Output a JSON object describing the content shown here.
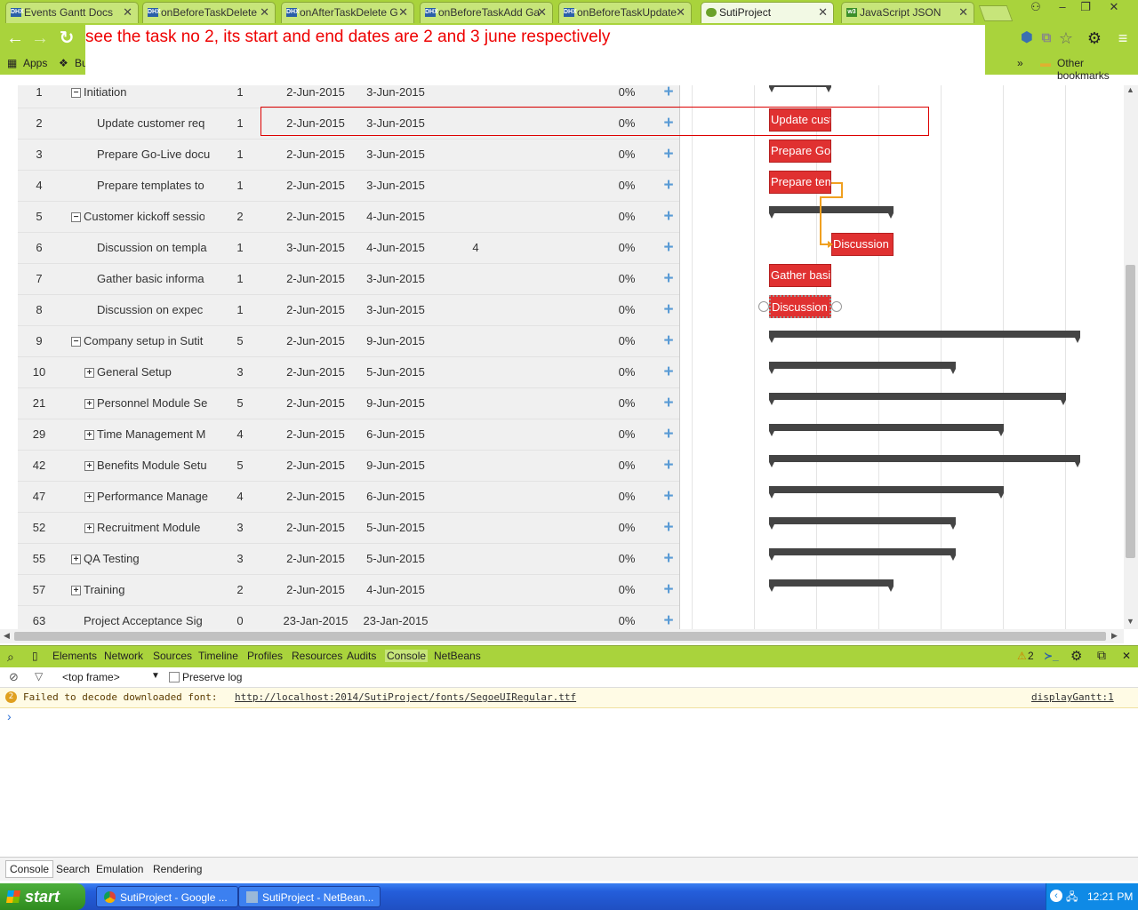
{
  "browser": {
    "tabs": [
      {
        "label": "Events Gantt Docs",
        "icon": "dhx-favicon"
      },
      {
        "label": "onBeforeTaskDelete",
        "icon": "dhx-favicon"
      },
      {
        "label": "onAfterTaskDelete G",
        "icon": "dhx-favicon"
      },
      {
        "label": "onBeforeTaskAdd Ga",
        "icon": "dhx-favicon"
      },
      {
        "label": "onBeforeTaskUpdate",
        "icon": "dhx-favicon"
      },
      {
        "label": "SutiProject",
        "icon": "suti-favicon"
      },
      {
        "label": "JavaScript JSON",
        "icon": "w3-favicon"
      }
    ],
    "bookmarks": {
      "apps": "Apps",
      "bu": "Bu",
      "chevron": "»",
      "other": "Other bookmarks"
    }
  },
  "notice": "see the task no 2, its start and end dates are 2 and 3 june respectively",
  "grid": {
    "rows": [
      {
        "id": "1",
        "name": "Initiation",
        "indent": 0,
        "toggle": "−",
        "dur": "1",
        "start": "2-Jun-2015",
        "end": "3-Jun-2015",
        "pred": "",
        "progress": "0%"
      },
      {
        "id": "2",
        "name": "Update customer req",
        "indent": 1,
        "toggle": "",
        "dur": "1",
        "start": "2-Jun-2015",
        "end": "3-Jun-2015",
        "pred": "",
        "progress": "0%"
      },
      {
        "id": "3",
        "name": "Prepare Go-Live docu",
        "indent": 1,
        "toggle": "",
        "dur": "1",
        "start": "2-Jun-2015",
        "end": "3-Jun-2015",
        "pred": "",
        "progress": "0%"
      },
      {
        "id": "4",
        "name": "Prepare templates to",
        "indent": 1,
        "toggle": "",
        "dur": "1",
        "start": "2-Jun-2015",
        "end": "3-Jun-2015",
        "pred": "",
        "progress": "0%"
      },
      {
        "id": "5",
        "name": "Customer kickoff sessio",
        "indent": 0,
        "toggle": "−",
        "dur": "2",
        "start": "2-Jun-2015",
        "end": "4-Jun-2015",
        "pred": "",
        "progress": "0%"
      },
      {
        "id": "6",
        "name": "Discussion on templa",
        "indent": 1,
        "toggle": "",
        "dur": "1",
        "start": "3-Jun-2015",
        "end": "4-Jun-2015",
        "pred": "4",
        "progress": "0%"
      },
      {
        "id": "7",
        "name": "Gather basic informa",
        "indent": 1,
        "toggle": "",
        "dur": "1",
        "start": "2-Jun-2015",
        "end": "3-Jun-2015",
        "pred": "",
        "progress": "0%"
      },
      {
        "id": "8",
        "name": "Discussion on expec",
        "indent": 1,
        "toggle": "",
        "dur": "1",
        "start": "2-Jun-2015",
        "end": "3-Jun-2015",
        "pred": "",
        "progress": "0%"
      },
      {
        "id": "9",
        "name": "Company setup in Sutit",
        "indent": 0,
        "toggle": "−",
        "dur": "5",
        "start": "2-Jun-2015",
        "end": "9-Jun-2015",
        "pred": "",
        "progress": "0%"
      },
      {
        "id": "10",
        "name": "General Setup",
        "indent": 1,
        "toggle": "+",
        "dur": "3",
        "start": "2-Jun-2015",
        "end": "5-Jun-2015",
        "pred": "",
        "progress": "0%"
      },
      {
        "id": "21",
        "name": "Personnel Module Se",
        "indent": 1,
        "toggle": "+",
        "dur": "5",
        "start": "2-Jun-2015",
        "end": "9-Jun-2015",
        "pred": "",
        "progress": "0%"
      },
      {
        "id": "29",
        "name": "Time Management M",
        "indent": 1,
        "toggle": "+",
        "dur": "4",
        "start": "2-Jun-2015",
        "end": "6-Jun-2015",
        "pred": "",
        "progress": "0%"
      },
      {
        "id": "42",
        "name": "Benefits Module Setu",
        "indent": 1,
        "toggle": "+",
        "dur": "5",
        "start": "2-Jun-2015",
        "end": "9-Jun-2015",
        "pred": "",
        "progress": "0%"
      },
      {
        "id": "47",
        "name": "Performance Manage",
        "indent": 1,
        "toggle": "+",
        "dur": "4",
        "start": "2-Jun-2015",
        "end": "6-Jun-2015",
        "pred": "",
        "progress": "0%"
      },
      {
        "id": "52",
        "name": "Recruitment Module",
        "indent": 1,
        "toggle": "+",
        "dur": "3",
        "start": "2-Jun-2015",
        "end": "5-Jun-2015",
        "pred": "",
        "progress": "0%"
      },
      {
        "id": "55",
        "name": "QA Testing",
        "indent": 0,
        "toggle": "+",
        "dur": "3",
        "start": "2-Jun-2015",
        "end": "5-Jun-2015",
        "pred": "",
        "progress": "0%"
      },
      {
        "id": "57",
        "name": "Training",
        "indent": 0,
        "toggle": "+",
        "dur": "2",
        "start": "2-Jun-2015",
        "end": "4-Jun-2015",
        "pred": "",
        "progress": "0%"
      },
      {
        "id": "63",
        "name": "Project Acceptance Sig",
        "indent": 0,
        "toggle": "",
        "dur": "0",
        "start": "23-Jan-2015",
        "end": "23-Jan-2015",
        "pred": "",
        "progress": "0%"
      }
    ],
    "add_symbol": "+"
  },
  "chart": {
    "bar_color": "#e03131",
    "project_color": "#444444",
    "link_color": "#f0a020",
    "bar_labels": [
      "Update custo",
      "Prepare Go-",
      "Prepare tem",
      "Discussion o",
      "Gather basic",
      "Discussion"
    ]
  },
  "devtools": {
    "tabs": [
      "Elements",
      "Network",
      "Sources",
      "Timeline",
      "Profiles",
      "Resources",
      "Audits",
      "Console",
      "NetBeans"
    ],
    "active_tab": "Console",
    "warn_count": "2",
    "frame": "<top frame>",
    "preserve_log": "Preserve log",
    "message_count": "2",
    "message_text": "Failed to decode downloaded font: ",
    "message_url": "http://localhost:2014/SutiProject/fonts/SegoeUIRegular.ttf",
    "message_source": "displayGantt:1",
    "prompt": "›",
    "bottom_tabs": [
      "Console",
      "Search",
      "Emulation",
      "Rendering"
    ]
  },
  "taskbar": {
    "start": "start",
    "items": [
      "SutiProject - Google ...",
      "SutiProject - NetBean..."
    ],
    "clock": "12:21 PM"
  }
}
